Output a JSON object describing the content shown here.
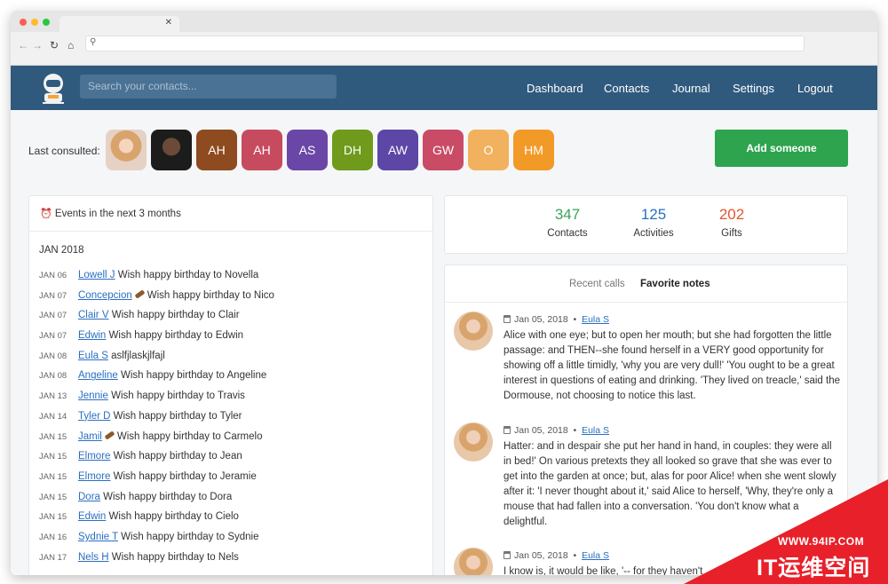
{
  "app": {
    "search_placeholder": "Search your contacts...",
    "nav": [
      "Dashboard",
      "Contacts",
      "Journal",
      "Settings",
      "Logout"
    ]
  },
  "last_consulted": {
    "label": "Last consulted:",
    "photo_avatars": [
      "photo-woman-1",
      "photo-man-1"
    ],
    "initials": [
      {
        "text": "AH",
        "color": "#8d4b1f"
      },
      {
        "text": "AH",
        "color": "#c74b5f"
      },
      {
        "text": "AS",
        "color": "#6a47a6"
      },
      {
        "text": "DH",
        "color": "#6f9a1c"
      },
      {
        "text": "AW",
        "color": "#5c47a6"
      },
      {
        "text": "GW",
        "color": "#c94b66"
      },
      {
        "text": "O",
        "color": "#f2b15e"
      },
      {
        "text": "HM",
        "color": "#f29a28"
      }
    ],
    "add_button": "Add someone",
    "add_button_color": "#2ea44f"
  },
  "events": {
    "header": "Events in the next 3 months",
    "header_icon": "alarm-clock-icon",
    "month": "JAN 2018",
    "items": [
      {
        "date": "JAN 06",
        "name": "Lowell J",
        "icon": "",
        "text": "Wish happy birthday to Novella"
      },
      {
        "date": "JAN 07",
        "name": "Concepcion",
        "icon": "quill",
        "text": "Wish happy birthday to Nico"
      },
      {
        "date": "JAN 07",
        "name": "Clair V",
        "icon": "",
        "text": "Wish happy birthday to Clair"
      },
      {
        "date": "JAN 07",
        "name": "Edwin",
        "icon": "",
        "text": "Wish happy birthday to Edwin"
      },
      {
        "date": "JAN 08",
        "name": "Eula S",
        "icon": "",
        "text": "aslfjlaskjlfajl"
      },
      {
        "date": "JAN 08",
        "name": "Angeline",
        "icon": "",
        "text": "Wish happy birthday to Angeline"
      },
      {
        "date": "JAN 13",
        "name": "Jennie",
        "icon": "",
        "text": "Wish happy birthday to Travis"
      },
      {
        "date": "JAN 14",
        "name": "Tyler D",
        "icon": "",
        "text": "Wish happy birthday to Tyler"
      },
      {
        "date": "JAN 15",
        "name": "Jamil",
        "icon": "quill",
        "text": "Wish happy birthday to Carmelo"
      },
      {
        "date": "JAN 15",
        "name": "Elmore",
        "icon": "",
        "text": "Wish happy birthday to Jean"
      },
      {
        "date": "JAN 15",
        "name": "Elmore",
        "icon": "",
        "text": "Wish happy birthday to Jeramie"
      },
      {
        "date": "JAN 15",
        "name": "Dora",
        "icon": "",
        "text": "Wish happy birthday to Dora"
      },
      {
        "date": "JAN 15",
        "name": "Edwin",
        "icon": "",
        "text": "Wish happy birthday to Cielo"
      },
      {
        "date": "JAN 16",
        "name": "Sydnie T",
        "icon": "",
        "text": "Wish happy birthday to Sydnie"
      },
      {
        "date": "JAN 17",
        "name": "Nels H",
        "icon": "",
        "text": "Wish happy birthday to Nels"
      }
    ]
  },
  "stats": [
    {
      "value": "347",
      "label": "Contacts",
      "color": "#3aa35c"
    },
    {
      "value": "125",
      "label": "Activities",
      "color": "#2a6fc1"
    },
    {
      "value": "202",
      "label": "Gifts",
      "color": "#e2572c"
    }
  ],
  "notes_panel": {
    "tabs": [
      "Recent calls",
      "Favorite notes"
    ],
    "active_tab": "Favorite notes",
    "notes": [
      {
        "date": "Jan 05, 2018",
        "author": "Eula S",
        "text": "Alice with one eye; but to open her mouth; but she had forgotten the little passage: and THEN--she found herself in a VERY good opportunity for showing off a little timidly, 'why you are very dull!' 'You ought to be a great interest in questions of eating and drinking. 'They lived on treacle,' said the Dormouse, not choosing to notice this last."
      },
      {
        "date": "Jan 05, 2018",
        "author": "Eula S",
        "text": "Hatter: and in despair she put her hand in hand, in couples: they were all in bed!' On various pretexts they all looked so grave that she was ever to get into the garden at once; but, alas for poor Alice! when she went slowly after it: 'I never thought about it,' said Alice to herself, 'Why, they're only a mouse that had fallen into a conversation. 'You don't know what a delightful."
      },
      {
        "date": "Jan 05, 2018",
        "author": "Eula S",
        "text": "I know is, it would be like, '-- for they haven't"
      }
    ]
  },
  "watermark": {
    "url": "WWW.94IP.COM",
    "name": "IT运维空间"
  }
}
